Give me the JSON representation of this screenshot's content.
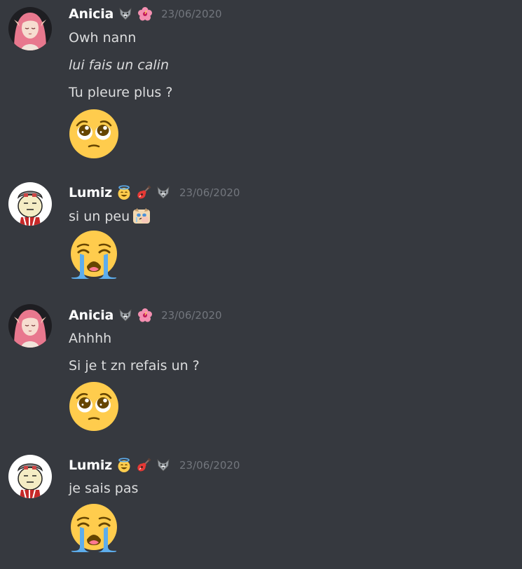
{
  "messages": [
    {
      "author": "Anicia",
      "badges": [
        "wolf-icon",
        "hibiscus-icon"
      ],
      "timestamp": "23/06/2020",
      "lines": [
        {
          "text": "Owh nann",
          "italic": false
        },
        {
          "text": "lui fais un calin",
          "italic": true
        },
        {
          "text": "Tu pleure plus ?",
          "italic": false
        }
      ],
      "big_emoji": "pleading-face-emoji"
    },
    {
      "author": "Lumiz",
      "badges": [
        "halo-face-icon",
        "guitar-icon",
        "wolf-icon"
      ],
      "timestamp": "23/06/2020",
      "lines": [
        {
          "text": "si un peu",
          "italic": false,
          "inline_emoji": "crying-cat-emote"
        }
      ],
      "big_emoji": "loudly-crying-face-emoji"
    },
    {
      "author": "Anicia",
      "badges": [
        "wolf-icon",
        "hibiscus-icon"
      ],
      "timestamp": "23/06/2020",
      "lines": [
        {
          "text": "Ahhhh",
          "italic": false
        },
        {
          "text": "Si je t zn refais un ?",
          "italic": false
        }
      ],
      "big_emoji": "pleading-face-emoji"
    },
    {
      "author": "Lumiz",
      "badges": [
        "halo-face-icon",
        "guitar-icon",
        "wolf-icon"
      ],
      "timestamp": "23/06/2020",
      "lines": [
        {
          "text": "je sais pas",
          "italic": false
        }
      ],
      "big_emoji": "loudly-crying-face-emoji"
    }
  ],
  "colors": {
    "background": "#36393f",
    "username": "#ffffff",
    "timestamp": "#72767d",
    "message_text": "#dcddde"
  }
}
